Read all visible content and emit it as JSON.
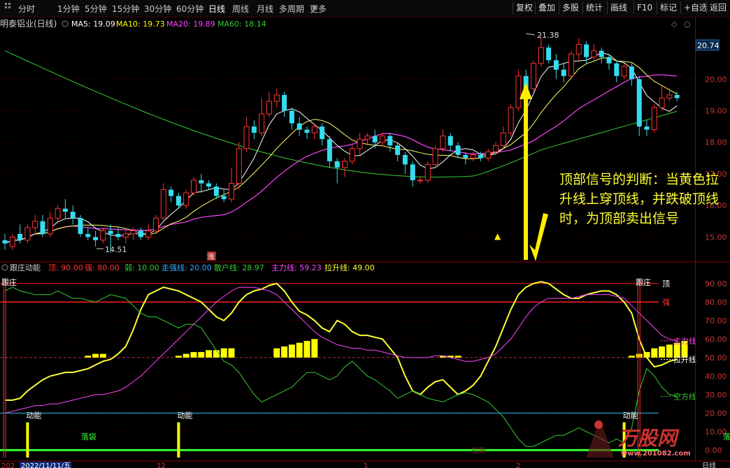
{
  "toolbar": {
    "periods": [
      "分时",
      "1分钟",
      "5分钟",
      "15分钟",
      "30分钟",
      "60分钟",
      "日线",
      "周线",
      "月线",
      "多周期",
      "更多"
    ],
    "active_period": "日线",
    "more_chevron": "›",
    "right_buttons": [
      "复权",
      "叠加",
      "多股",
      "统计",
      "画线",
      "F10",
      "标记",
      "+自选",
      "返回"
    ]
  },
  "main_panel": {
    "title": "明泰铝业(日线)",
    "ma": [
      {
        "label": "MA5: 19.09",
        "color": "#ffffff"
      },
      {
        "label": "MA10: 19.73",
        "color": "#ffff00"
      },
      {
        "label": "MA20: 19.89",
        "color": "#ff44ff"
      },
      {
        "label": "MA60: 18.14",
        "color": "#33cc33"
      }
    ],
    "price_badge": "20.74",
    "high_label": "21.38",
    "low_label": "14.51",
    "zhang_label": "涨",
    "triangle": "▲"
  },
  "annotation": {
    "text": "顶部信号的判断：当黄色拉升线上穿顶线，并跌破顶线时，为顶部卖出信号"
  },
  "indicator_panel": {
    "name": "跟庄动能",
    "params": [
      {
        "label": "顶: 90.00",
        "color": "#ff3333"
      },
      {
        "label": "强: 80.00",
        "color": "#ff3333"
      },
      {
        "label": "弱: 10.00",
        "color": "#33cc33"
      },
      {
        "label": "走强线: 20.00",
        "color": "#33aaff"
      },
      {
        "label": "散户线: 28.97",
        "color": "#33cc33"
      },
      {
        "label": "主力线: 59.23",
        "color": "#ff44ff"
      },
      {
        "label": "拉升线: 49.00",
        "color": "#ffff33"
      }
    ],
    "marks": {
      "genzhuang": "跟庄",
      "dongneng": "动能",
      "luodai": "落袋",
      "top": "顶",
      "strong": "强",
      "zhuli": "主力线",
      "lasheng": "拉升线",
      "kongfang": "空方线",
      "hidden_text": "拉升"
    }
  },
  "status_bar": {
    "date": "2022/11/11/五",
    "left": "202",
    "mid1": "12",
    "mid2": "1",
    "mid3": "2",
    "right": "日线"
  },
  "watermark": {
    "brand": "万股网",
    "url": "www.201082.com"
  },
  "chart_data": [
    {
      "type": "candlestick",
      "title": "明泰铝业(日线)",
      "y_ticks": [
        15.0,
        16.0,
        17.0,
        18.0,
        19.0,
        20.0
      ],
      "ylim": [
        14.3,
        21.6
      ],
      "candles": [
        [
          14.9,
          14.8,
          15.1,
          14.6
        ],
        [
          14.7,
          15.0,
          15.1,
          14.6
        ],
        [
          15.1,
          14.9,
          15.4,
          14.8
        ],
        [
          14.9,
          15.3,
          15.4,
          14.8
        ],
        [
          15.3,
          15.5,
          15.7,
          15.1
        ],
        [
          15.5,
          15.1,
          15.7,
          15.0
        ],
        [
          15.1,
          15.6,
          15.8,
          15.0
        ],
        [
          15.6,
          15.9,
          16.0,
          15.5
        ],
        [
          15.9,
          15.8,
          16.2,
          15.6
        ],
        [
          15.8,
          15.6,
          16.0,
          15.4
        ],
        [
          15.6,
          15.1,
          15.7,
          15.0
        ],
        [
          15.1,
          15.0,
          15.3,
          14.9
        ],
        [
          15.0,
          14.9,
          15.2,
          14.7
        ],
        [
          14.9,
          15.2,
          15.3,
          14.8
        ],
        [
          15.2,
          15.1,
          15.4,
          14.5
        ],
        [
          15.1,
          15.0,
          15.3,
          14.9
        ],
        [
          15.0,
          15.1,
          15.2,
          14.8
        ],
        [
          15.1,
          15.2,
          15.3,
          14.9
        ],
        [
          15.2,
          15.0,
          15.3,
          14.9
        ],
        [
          15.0,
          15.2,
          15.4,
          14.9
        ],
        [
          15.2,
          15.6,
          15.7,
          15.1
        ],
        [
          15.6,
          16.5,
          16.7,
          15.5
        ],
        [
          16.5,
          16.3,
          16.6,
          16.1
        ],
        [
          16.3,
          16.0,
          16.4,
          15.9
        ],
        [
          16.0,
          16.4,
          16.5,
          15.9
        ],
        [
          16.4,
          16.8,
          16.9,
          16.3
        ],
        [
          16.8,
          16.7,
          17.0,
          16.4
        ],
        [
          16.7,
          16.6,
          16.8,
          16.5
        ],
        [
          16.6,
          16.3,
          16.7,
          16.2
        ],
        [
          16.3,
          16.2,
          16.5,
          16.1
        ],
        [
          16.2,
          16.7,
          17.2,
          16.1
        ],
        [
          16.7,
          17.8,
          18.0,
          16.5
        ],
        [
          17.8,
          18.5,
          18.8,
          17.7
        ],
        [
          18.5,
          18.3,
          18.7,
          18.1
        ],
        [
          18.3,
          18.9,
          19.4,
          18.2
        ],
        [
          18.9,
          19.3,
          19.6,
          18.8
        ],
        [
          19.3,
          19.5,
          19.7,
          19.1
        ],
        [
          19.5,
          19.0,
          19.6,
          18.8
        ],
        [
          19.0,
          18.6,
          19.1,
          18.4
        ],
        [
          18.6,
          18.4,
          18.8,
          18.2
        ],
        [
          18.4,
          18.3,
          18.5,
          18.1
        ],
        [
          18.3,
          18.5,
          18.6,
          18.1
        ],
        [
          18.5,
          18.1,
          18.6,
          17.9
        ],
        [
          18.1,
          17.4,
          18.2,
          17.2
        ],
        [
          17.4,
          17.2,
          17.5,
          16.7
        ],
        [
          17.2,
          17.4,
          17.5,
          16.9
        ],
        [
          17.4,
          17.8,
          17.9,
          17.3
        ],
        [
          17.8,
          18.1,
          18.3,
          17.6
        ],
        [
          18.1,
          18.2,
          18.3,
          17.9
        ],
        [
          18.2,
          18.0,
          18.4,
          17.8
        ],
        [
          18.0,
          18.2,
          18.3,
          17.9
        ],
        [
          18.2,
          17.9,
          18.3,
          17.7
        ],
        [
          17.9,
          17.6,
          18.0,
          17.4
        ],
        [
          17.6,
          17.3,
          17.7,
          17.0
        ],
        [
          17.3,
          16.8,
          17.4,
          16.6
        ],
        [
          16.8,
          16.8,
          16.9,
          16.7
        ],
        [
          16.8,
          17.3,
          17.4,
          16.7
        ],
        [
          17.3,
          17.8,
          17.9,
          17.2
        ],
        [
          17.8,
          18.2,
          18.4,
          17.7
        ],
        [
          18.2,
          17.9,
          18.3,
          17.7
        ],
        [
          17.9,
          17.6,
          18.0,
          17.5
        ],
        [
          17.6,
          17.5,
          17.7,
          17.3
        ],
        [
          17.5,
          17.6,
          17.7,
          17.4
        ],
        [
          17.6,
          17.5,
          17.7,
          17.4
        ],
        [
          17.5,
          17.7,
          17.8,
          17.4
        ],
        [
          17.7,
          17.9,
          18.0,
          17.6
        ],
        [
          17.9,
          18.3,
          18.5,
          17.8
        ],
        [
          18.3,
          19.1,
          19.2,
          18.2
        ],
        [
          19.1,
          20.1,
          20.3,
          19.0
        ],
        [
          20.1,
          19.7,
          20.3,
          19.6
        ],
        [
          19.7,
          20.5,
          20.6,
          19.6
        ],
        [
          20.5,
          21.0,
          21.4,
          20.4
        ],
        [
          21.0,
          20.6,
          21.1,
          20.5
        ],
        [
          20.6,
          20.3,
          20.8,
          20.0
        ],
        [
          20.3,
          20.1,
          20.5,
          19.9
        ],
        [
          20.1,
          20.8,
          20.9,
          20.0
        ],
        [
          20.8,
          21.1,
          21.3,
          20.6
        ],
        [
          21.1,
          20.7,
          21.2,
          20.5
        ],
        [
          20.7,
          20.9,
          21.1,
          20.6
        ],
        [
          20.9,
          20.7,
          21.0,
          20.5
        ],
        [
          20.7,
          20.5,
          20.8,
          20.3
        ],
        [
          20.5,
          20.1,
          20.6,
          19.9
        ],
        [
          20.1,
          20.4,
          20.5,
          20.0
        ],
        [
          20.4,
          20.0,
          20.5,
          19.8
        ],
        [
          20.0,
          18.5,
          20.1,
          18.2
        ],
        [
          18.5,
          18.4,
          18.7,
          18.2
        ],
        [
          18.4,
          19.1,
          19.2,
          18.3
        ],
        [
          19.1,
          19.4,
          19.8,
          19.0
        ],
        [
          19.4,
          19.5,
          19.7,
          19.3
        ],
        [
          19.5,
          19.4,
          19.6,
          19.3
        ]
      ]
    },
    {
      "type": "line",
      "title": "跟庄动能",
      "y_ticks": [
        0,
        10,
        20,
        30,
        40,
        50,
        60,
        70,
        80,
        90
      ],
      "ylim": [
        -4,
        96
      ],
      "reference_lines": {
        "顶": 90,
        "强": 80,
        "弱": 0,
        "走强线": 20,
        "midline": 50
      },
      "series": [
        {
          "name": "拉升线",
          "color": "#ffff33",
          "values": [
            27,
            27,
            28,
            32,
            35,
            38,
            40,
            41,
            42,
            42,
            43,
            44,
            46,
            48,
            49,
            52,
            56,
            65,
            76,
            84,
            86,
            88,
            87,
            86,
            84,
            82,
            80,
            76,
            72,
            70,
            74,
            80,
            84,
            86,
            87,
            89,
            90,
            86,
            80,
            75,
            73,
            70,
            66,
            64,
            70,
            68,
            64,
            62,
            62,
            61,
            60,
            55,
            50,
            40,
            32,
            30,
            34,
            37,
            38,
            34,
            30,
            32,
            35,
            40,
            48,
            56,
            66,
            76,
            84,
            88,
            90,
            91,
            90,
            87,
            84,
            82,
            82,
            84,
            85,
            86,
            86,
            84,
            80,
            74,
            60,
            50,
            45,
            46,
            48,
            49
          ]
        },
        {
          "name": "主力线",
          "color": "#ff44ff",
          "values": [
            20,
            21,
            22,
            23,
            24,
            24,
            25,
            25,
            26,
            27,
            28,
            29,
            30,
            30,
            31,
            32,
            34,
            37,
            40,
            44,
            48,
            52,
            56,
            60,
            64,
            68,
            72,
            76,
            80,
            83,
            86,
            88,
            88,
            88,
            87,
            86,
            84,
            80,
            76,
            72,
            68,
            64,
            61,
            59,
            57,
            56,
            55,
            55,
            54,
            54,
            53,
            52,
            51,
            50,
            50,
            50,
            50,
            51,
            51,
            50,
            49,
            48,
            48,
            49,
            50,
            52,
            56,
            60,
            66,
            72,
            77,
            80,
            82,
            82,
            82,
            82,
            83,
            84,
            84,
            84,
            84,
            83,
            82,
            78,
            74,
            70,
            66,
            62,
            60,
            59
          ]
        },
        {
          "name": "散户线",
          "color": "#33cc33",
          "values": [
            86,
            88,
            86,
            85,
            84,
            84,
            84,
            86,
            84,
            82,
            82,
            81,
            80,
            82,
            84,
            83,
            82,
            78,
            74,
            72,
            72,
            70,
            68,
            66,
            68,
            68,
            66,
            60,
            54,
            48,
            46,
            42,
            36,
            30,
            26,
            28,
            30,
            32,
            34,
            38,
            42,
            42,
            40,
            38,
            40,
            45,
            48,
            44,
            40,
            38,
            35,
            32,
            28,
            30,
            32,
            30,
            28,
            27,
            26,
            28,
            30,
            31,
            30,
            28,
            26,
            22,
            18,
            12,
            6,
            2,
            2,
            4,
            6,
            8,
            8,
            10,
            12,
            10,
            8,
            6,
            4,
            6,
            4,
            12,
            32,
            44,
            40,
            34,
            30,
            29
          ]
        }
      ],
      "bars": [
        {
          "name": "拉升柱",
          "color": "#ffff00",
          "start": 11,
          "values": [
            51,
            52,
            52
          ]
        },
        {
          "name": "拉升柱",
          "color": "#ffff00",
          "start": 23,
          "values": [
            51,
            52,
            53,
            53,
            54,
            54,
            55,
            55
          ]
        },
        {
          "name": "拉升柱",
          "color": "#ffff00",
          "start": 36,
          "values": [
            55,
            56,
            57,
            58,
            59,
            60
          ]
        },
        {
          "name": "拉升柱",
          "color": "#ffff00",
          "start": 58,
          "values": [
            51,
            51,
            51
          ]
        },
        {
          "name": "拉升柱",
          "color": "#ffff00",
          "start": 83,
          "values": [
            51,
            52,
            53,
            55,
            56,
            57,
            58,
            59
          ]
        }
      ],
      "signals": [
        {
          "type": "跟庄",
          "index": 0
        },
        {
          "type": "跟庄",
          "index": 84
        },
        {
          "type": "动能",
          "index": 3
        },
        {
          "type": "动能",
          "index": 23
        },
        {
          "type": "动能",
          "index": 82
        },
        {
          "type": "落袋",
          "index": 11
        },
        {
          "type": "落袋",
          "index": 96
        }
      ]
    }
  ]
}
